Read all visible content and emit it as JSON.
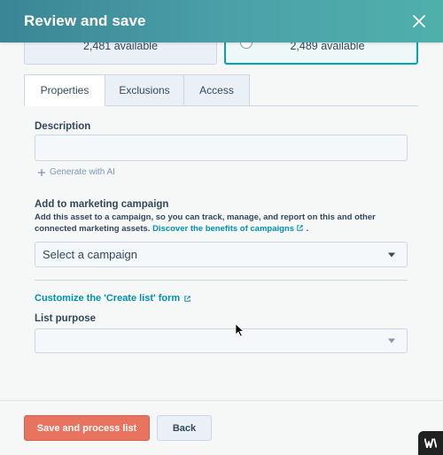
{
  "header": {
    "title": "Review and save"
  },
  "cards": [
    {
      "available": "2,481 available"
    },
    {
      "available": "2,489 available"
    }
  ],
  "tabs": [
    {
      "label": "Properties"
    },
    {
      "label": "Exclusions"
    },
    {
      "label": "Access"
    }
  ],
  "description": {
    "label": "Description",
    "value": "",
    "generate_ai": "Generate with AI"
  },
  "campaign": {
    "label": "Add to marketing campaign",
    "help_text": "Add this asset to a campaign, so you can track, manage, and report on this and other connected marketing assets.",
    "help_link": "Discover the benefits of campaigns",
    "help_suffix": ".",
    "select_value": "Select a campaign"
  },
  "customize_link": "Customize the 'Create list' form",
  "list_purpose": {
    "label": "List purpose",
    "value": ""
  },
  "footer": {
    "primary": "Save and process list",
    "secondary": "Back"
  },
  "colors": {
    "header_start": "#3a8596",
    "header_end": "#4fb0ab",
    "primary_button": "#e8735f",
    "link": "#0091ae",
    "selected_card_border": "#00a4bd"
  },
  "icons": {
    "close": "close-icon",
    "sparkle": "sparkle-icon",
    "external": "external-link-icon",
    "caret": "caret-down-icon",
    "cursor": "mouse-cursor-icon",
    "logo": "logo-icon"
  }
}
